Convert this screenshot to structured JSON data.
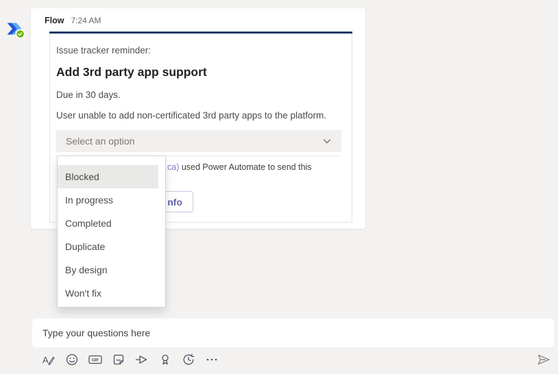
{
  "colors": {
    "accent_bar": "#1b3a66",
    "footer_link": "#7b83c9",
    "button_text": "#6264a7",
    "presence_green": "#6bb700",
    "flow_logo_dark": "#1f57d4",
    "flow_logo_light": "#5fa9f4"
  },
  "message": {
    "sender": "Flow",
    "time": "7:24 AM",
    "card": {
      "intro": "Issue tracker reminder:",
      "title": "Add 3rd party app support",
      "due": "Due in 30 days.",
      "description": "User unable to add non-certificated 3rd party apps to the platform.",
      "select_placeholder": "Select an option",
      "footer_link_fragment": "ca)",
      "footer_text_fragment": " used Power Automate to send this",
      "action_button_visible_label": "nfo"
    }
  },
  "dropdown": {
    "options": [
      "Blocked",
      "In progress",
      "Completed",
      "Duplicate",
      "By design",
      "Won't fix"
    ],
    "highlighted_index": 0
  },
  "compose": {
    "placeholder": "Type your questions here",
    "gif_label": "GIF",
    "format_glyph": "A",
    "toolbar_icons": [
      "format",
      "emoji",
      "gif",
      "sticker",
      "stream",
      "praise",
      "refresh",
      "more"
    ]
  }
}
